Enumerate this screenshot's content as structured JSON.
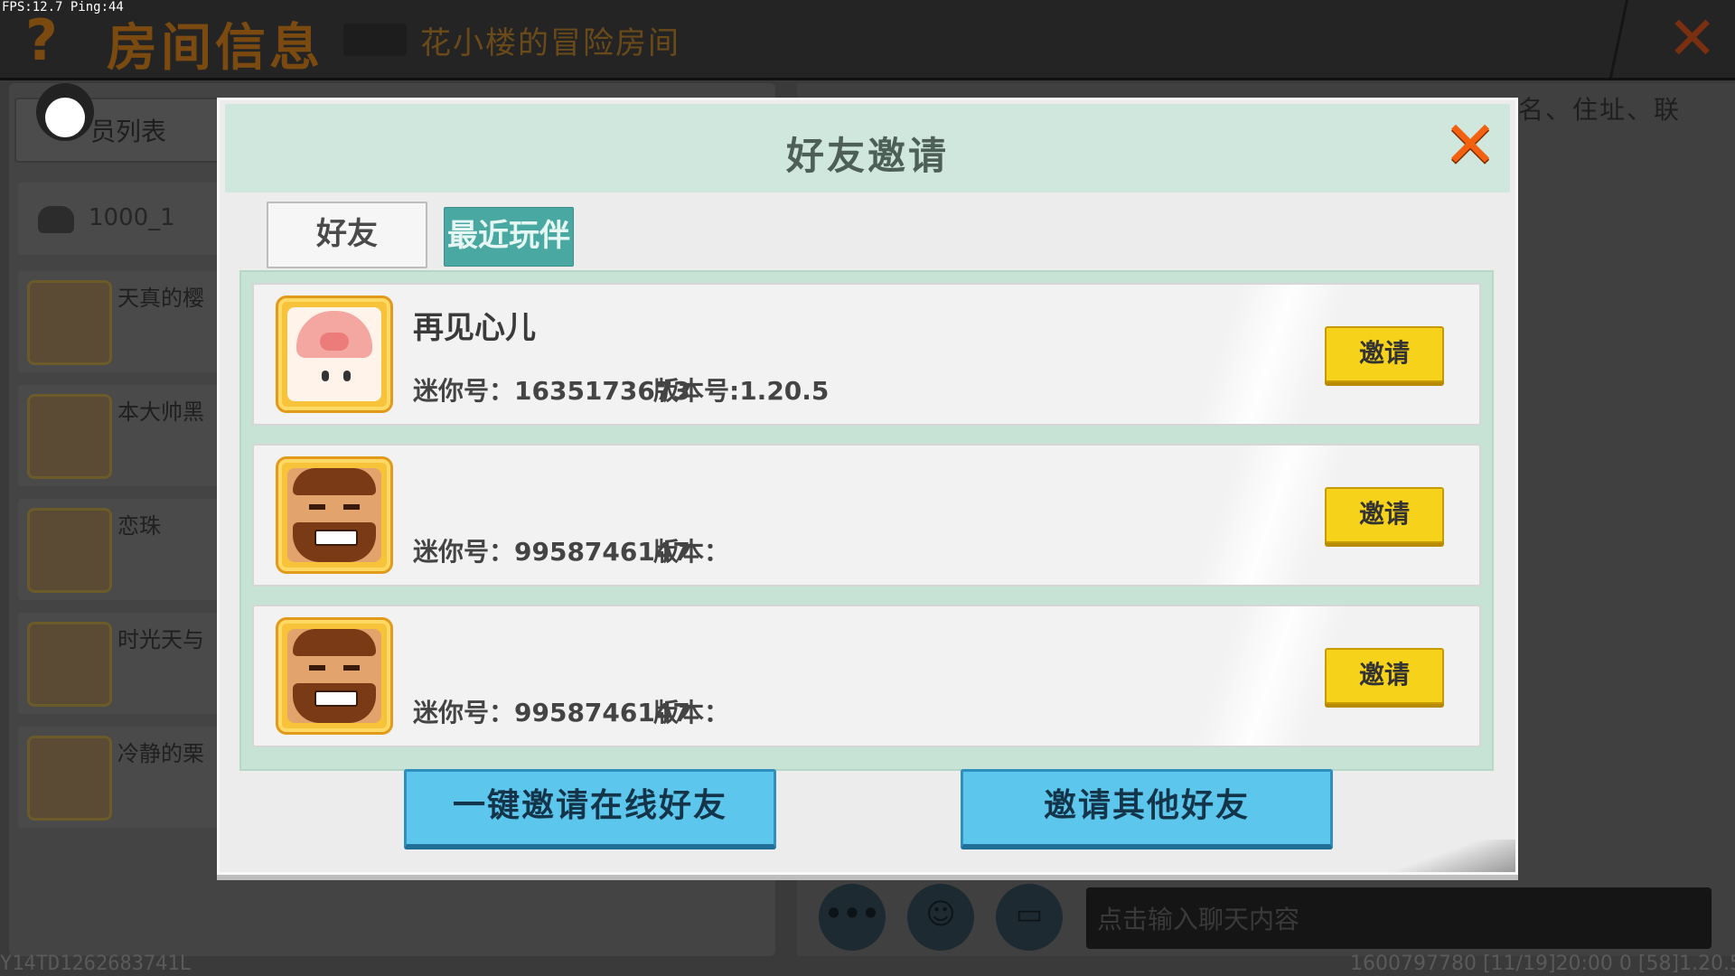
{
  "hud": {
    "fps": "FPS:12.7  Ping:44"
  },
  "header": {
    "title": "房间信息",
    "room_name": "花小楼的冒险房间"
  },
  "left_panel": {
    "tab_label": "员列表",
    "room_id": "1000_1",
    "members": [
      "天真的樱",
      "本大帅黑",
      "恋珠",
      "时光天与",
      "冷静的栗"
    ]
  },
  "right_panel": {
    "search_hint": "名、住址、联"
  },
  "chat": {
    "input_placeholder": "点击输入聊天内容",
    "more_label": "•••"
  },
  "status_bar": {
    "left": "Y14TD1262683741L",
    "right": "1600797780   [11/19]20:00 0   [58]1.20.5"
  },
  "dialog": {
    "title": "好友邀请",
    "tabs": [
      {
        "label": "好友",
        "active": true
      },
      {
        "label": "最近玩伴",
        "active": false
      }
    ],
    "friends": [
      {
        "name": "再见心儿",
        "mini_id": "迷你号：1635173673",
        "version": "版本号:1.20.5",
        "invite_label": "邀请"
      },
      {
        "name": "",
        "mini_id": "迷你号：9958746147",
        "version": "版本：",
        "invite_label": "邀请"
      },
      {
        "name": "",
        "mini_id": "迷你号：9958746147",
        "version": "版本：",
        "invite_label": "邀请"
      }
    ],
    "invite_online_label": "一键邀请在线好友",
    "invite_others_label": "邀请其他好友"
  },
  "colors": {
    "header_green": "#cfe7dc",
    "tab_teal": "#4aa8a2",
    "invite_yellow": "#f7d21a",
    "action_blue": "#5cc6ec",
    "close_orange": "#f26010"
  }
}
